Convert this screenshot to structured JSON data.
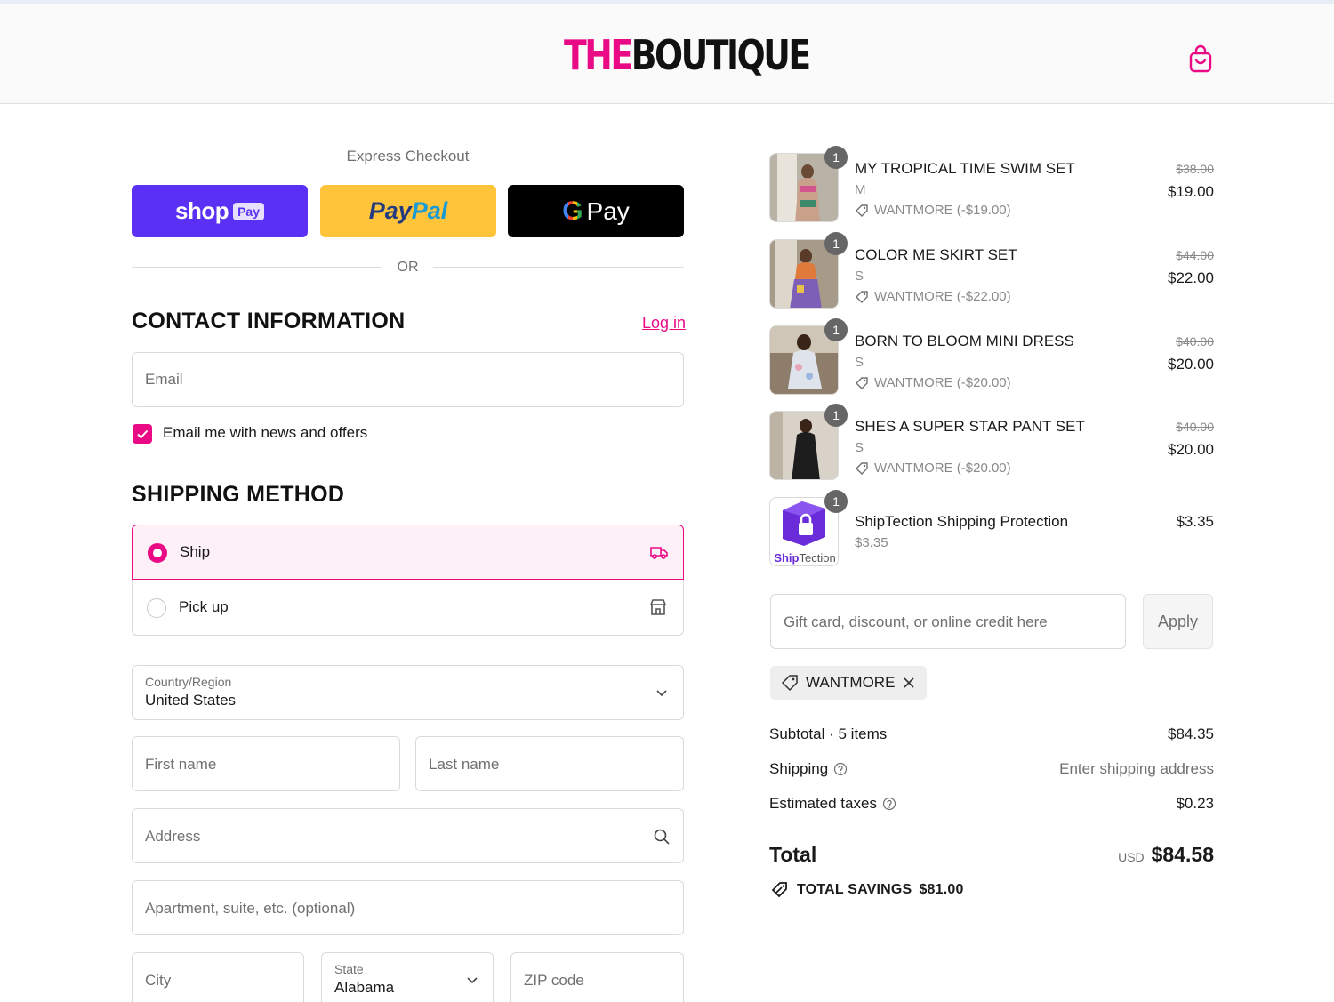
{
  "brand": {
    "logo_part1": "THE",
    "logo_part2": "BOUTIQUE",
    "accent": "#ea0a86"
  },
  "header": {
    "cart_icon": "shopping-bag-icon"
  },
  "express": {
    "label": "Express Checkout",
    "shop_pay": {
      "shop": "shop",
      "pay": "Pay"
    },
    "paypal": {
      "part1": "Pay",
      "part2": "Pal"
    },
    "gpay": {
      "g": "G",
      "pay": "Pay"
    },
    "or": "OR"
  },
  "contact": {
    "title": "CONTACT INFORMATION",
    "login": "Log in",
    "email_placeholder": "Email",
    "newsletter_label": "Email me with news and offers",
    "newsletter_checked": true
  },
  "shipping_method": {
    "title": "SHIPPING METHOD",
    "options": [
      {
        "label": "Ship",
        "selected": true,
        "icon": "delivery-truck-icon"
      },
      {
        "label": "Pick up",
        "selected": false,
        "icon": "store-icon"
      }
    ]
  },
  "address": {
    "country_label": "Country/Region",
    "country_value": "United States",
    "first_name_placeholder": "First name",
    "last_name_placeholder": "Last name",
    "address_placeholder": "Address",
    "apartment_placeholder": "Apartment, suite, etc. (optional)",
    "city_placeholder": "City",
    "state_label": "State",
    "state_value": "Alabama",
    "zip_placeholder": "ZIP code"
  },
  "cart": {
    "items": [
      {
        "qty": "1",
        "name": "MY TROPICAL TIME SWIM SET",
        "variant": "M",
        "discount": "WANTMORE (-$19.00)",
        "old_price": "$38.00",
        "price": "$19.00"
      },
      {
        "qty": "1",
        "name": "COLOR ME SKIRT SET",
        "variant": "S",
        "discount": "WANTMORE (-$22.00)",
        "old_price": "$44.00",
        "price": "$22.00"
      },
      {
        "qty": "1",
        "name": "BORN TO BLOOM MINI DRESS",
        "variant": "S",
        "discount": "WANTMORE (-$20.00)",
        "old_price": "$40.00",
        "price": "$20.00"
      },
      {
        "qty": "1",
        "name": "SHES A SUPER STAR PANT SET",
        "variant": "S",
        "discount": "WANTMORE (-$20.00)",
        "old_price": "$40.00",
        "price": "$20.00"
      },
      {
        "qty": "1",
        "name": "ShipTection Shipping Protection",
        "variant": "$3.35",
        "price": "$3.35",
        "logo_part1": "Ship",
        "logo_part2": "Tection"
      }
    ],
    "discount_placeholder": "Gift card, discount, or online credit here",
    "apply_label": "Apply",
    "applied_code": "WANTMORE"
  },
  "summary": {
    "subtotal_label": "Subtotal · 5 items",
    "subtotal_value": "$84.35",
    "shipping_label": "Shipping",
    "shipping_value": "Enter shipping address",
    "taxes_label": "Estimated taxes",
    "taxes_value": "$0.23",
    "total_label": "Total",
    "currency": "USD",
    "total_value": "$84.58",
    "savings_label": "TOTAL SAVINGS",
    "savings_value": "$81.00"
  }
}
